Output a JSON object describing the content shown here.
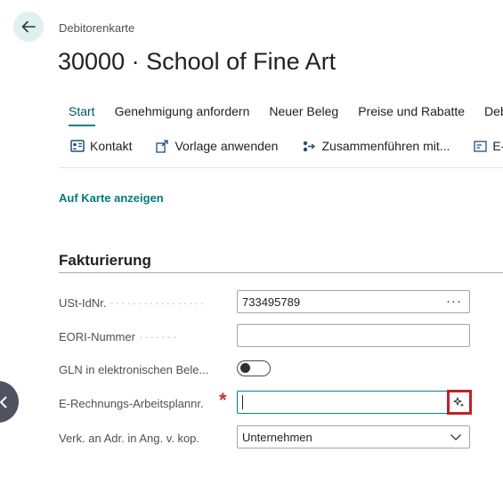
{
  "header": {
    "caption": "Debitorenkarte",
    "title": "30000 · School of Fine Art"
  },
  "tabs": [
    {
      "label": "Start",
      "active": true
    },
    {
      "label": "Genehmigung anfordern"
    },
    {
      "label": "Neuer Beleg"
    },
    {
      "label": "Preise und Rabatte"
    },
    {
      "label": "Debi"
    }
  ],
  "actions": [
    {
      "label": "Kontakt",
      "icon": "contact-card-icon"
    },
    {
      "label": "Vorlage anwenden",
      "icon": "apply-template-icon"
    },
    {
      "label": "Zusammenführen mit...",
      "icon": "merge-icon"
    },
    {
      "label": "E-M",
      "icon": "email-icon"
    }
  ],
  "links": {
    "show_on_map": "Auf Karte anzeigen"
  },
  "section": {
    "title": "Fakturierung"
  },
  "fields": {
    "vat_id": {
      "label": "USt-IdNr.",
      "value": "733495789",
      "assist": "···"
    },
    "eori": {
      "label": "EORI-Nummer",
      "value": ""
    },
    "gln": {
      "label": "GLN in elektronischen Bele...",
      "checked": false
    },
    "e_invoice": {
      "label": "E-Rechnungs-Arbeitsplannr.",
      "value": "",
      "required": "*"
    },
    "ship_addr": {
      "label": "Verk. an Adr. in Ang. v. kop.",
      "value": "Unternehmen"
    }
  },
  "colors": {
    "accent": "#008489",
    "link": "#007b80",
    "required": "#c6313a",
    "highlight_box": "#c02028"
  }
}
